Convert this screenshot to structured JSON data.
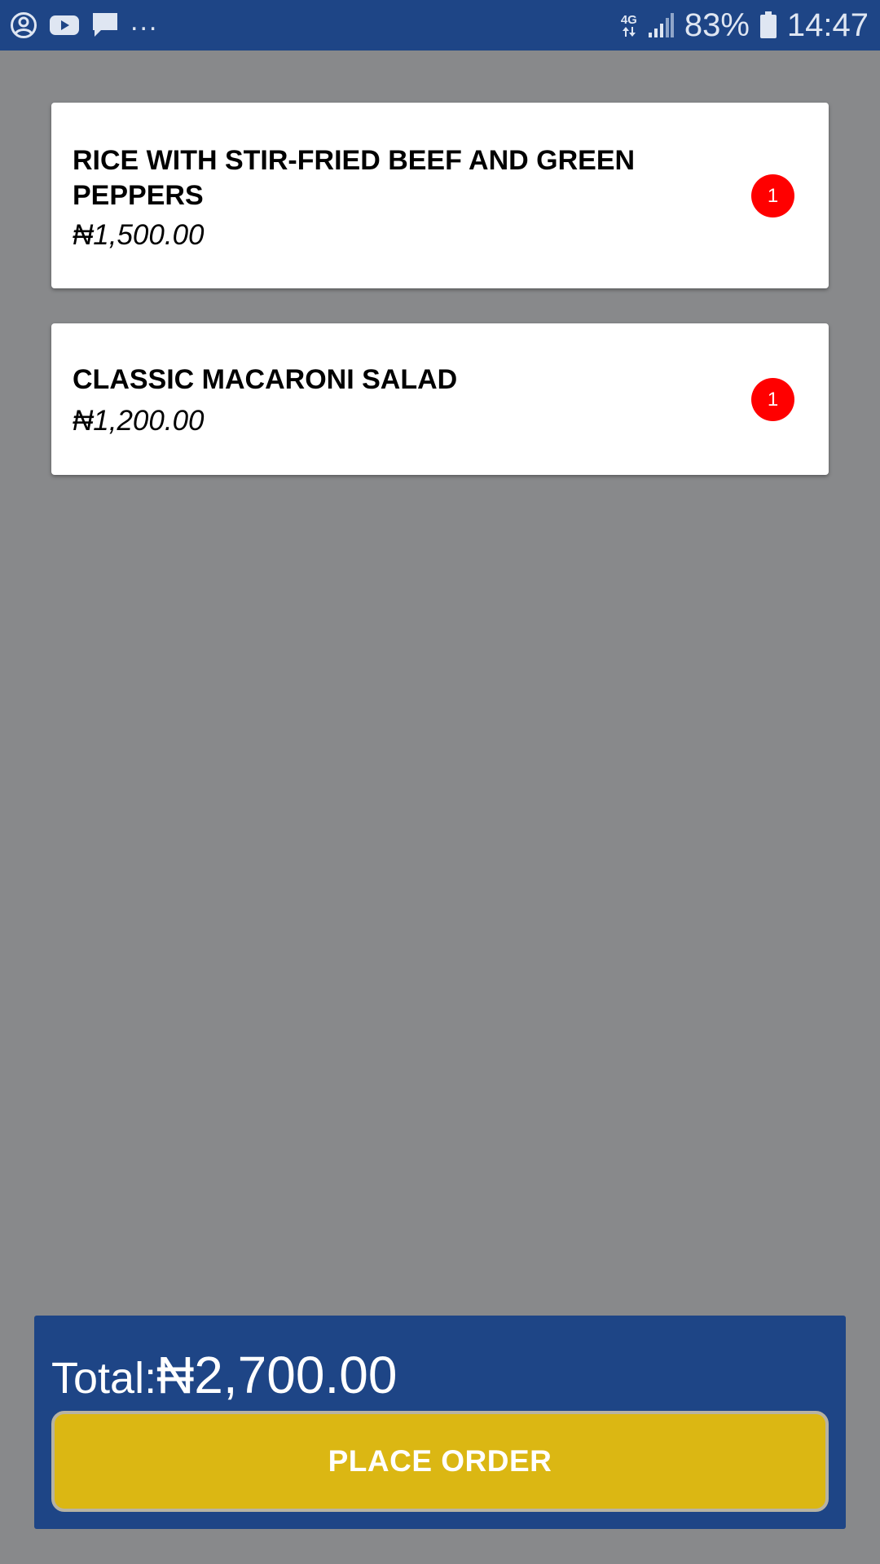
{
  "status_bar": {
    "network_type": "4G",
    "battery_percent": "83%",
    "time": "14:47",
    "more_notifications": "...",
    "left_icons": [
      "account-circle-icon",
      "youtube-icon",
      "message-icon"
    ],
    "right_icons": [
      "data-arrows-icon",
      "signal-icon",
      "battery-icon"
    ]
  },
  "cart": {
    "items": [
      {
        "name": "RICE WITH STIR-FRIED BEEF AND GREEN PEPPERS",
        "price": "₦1,500.00",
        "quantity": "1"
      },
      {
        "name": "CLASSIC MACARONI SALAD",
        "price": "₦1,200.00",
        "quantity": "1"
      }
    ]
  },
  "footer": {
    "total_label": "Total:",
    "total_amount": "₦2,700.00",
    "place_order_label": "PLACE ORDER"
  },
  "colors": {
    "primary_blue": "#1e4586",
    "background_gray": "#88898b",
    "badge_red": "#ff0000",
    "button_yellow": "#dbb713"
  }
}
